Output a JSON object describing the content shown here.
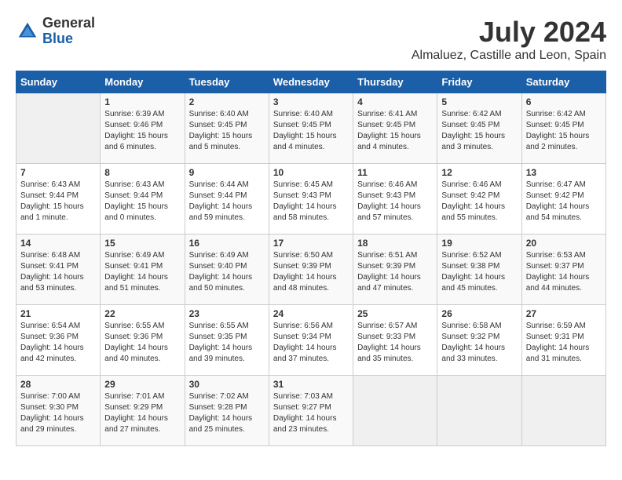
{
  "header": {
    "logo_general": "General",
    "logo_blue": "Blue",
    "month_year": "July 2024",
    "location": "Almaluez, Castille and Leon, Spain"
  },
  "days_of_week": [
    "Sunday",
    "Monday",
    "Tuesday",
    "Wednesday",
    "Thursday",
    "Friday",
    "Saturday"
  ],
  "weeks": [
    [
      {
        "day": "",
        "info": ""
      },
      {
        "day": "1",
        "info": "Sunrise: 6:39 AM\nSunset: 9:46 PM\nDaylight: 15 hours\nand 6 minutes."
      },
      {
        "day": "2",
        "info": "Sunrise: 6:40 AM\nSunset: 9:45 PM\nDaylight: 15 hours\nand 5 minutes."
      },
      {
        "day": "3",
        "info": "Sunrise: 6:40 AM\nSunset: 9:45 PM\nDaylight: 15 hours\nand 4 minutes."
      },
      {
        "day": "4",
        "info": "Sunrise: 6:41 AM\nSunset: 9:45 PM\nDaylight: 15 hours\nand 4 minutes."
      },
      {
        "day": "5",
        "info": "Sunrise: 6:42 AM\nSunset: 9:45 PM\nDaylight: 15 hours\nand 3 minutes."
      },
      {
        "day": "6",
        "info": "Sunrise: 6:42 AM\nSunset: 9:45 PM\nDaylight: 15 hours\nand 2 minutes."
      }
    ],
    [
      {
        "day": "7",
        "info": "Sunrise: 6:43 AM\nSunset: 9:44 PM\nDaylight: 15 hours\nand 1 minute."
      },
      {
        "day": "8",
        "info": "Sunrise: 6:43 AM\nSunset: 9:44 PM\nDaylight: 15 hours\nand 0 minutes."
      },
      {
        "day": "9",
        "info": "Sunrise: 6:44 AM\nSunset: 9:44 PM\nDaylight: 14 hours\nand 59 minutes."
      },
      {
        "day": "10",
        "info": "Sunrise: 6:45 AM\nSunset: 9:43 PM\nDaylight: 14 hours\nand 58 minutes."
      },
      {
        "day": "11",
        "info": "Sunrise: 6:46 AM\nSunset: 9:43 PM\nDaylight: 14 hours\nand 57 minutes."
      },
      {
        "day": "12",
        "info": "Sunrise: 6:46 AM\nSunset: 9:42 PM\nDaylight: 14 hours\nand 55 minutes."
      },
      {
        "day": "13",
        "info": "Sunrise: 6:47 AM\nSunset: 9:42 PM\nDaylight: 14 hours\nand 54 minutes."
      }
    ],
    [
      {
        "day": "14",
        "info": "Sunrise: 6:48 AM\nSunset: 9:41 PM\nDaylight: 14 hours\nand 53 minutes."
      },
      {
        "day": "15",
        "info": "Sunrise: 6:49 AM\nSunset: 9:41 PM\nDaylight: 14 hours\nand 51 minutes."
      },
      {
        "day": "16",
        "info": "Sunrise: 6:49 AM\nSunset: 9:40 PM\nDaylight: 14 hours\nand 50 minutes."
      },
      {
        "day": "17",
        "info": "Sunrise: 6:50 AM\nSunset: 9:39 PM\nDaylight: 14 hours\nand 48 minutes."
      },
      {
        "day": "18",
        "info": "Sunrise: 6:51 AM\nSunset: 9:39 PM\nDaylight: 14 hours\nand 47 minutes."
      },
      {
        "day": "19",
        "info": "Sunrise: 6:52 AM\nSunset: 9:38 PM\nDaylight: 14 hours\nand 45 minutes."
      },
      {
        "day": "20",
        "info": "Sunrise: 6:53 AM\nSunset: 9:37 PM\nDaylight: 14 hours\nand 44 minutes."
      }
    ],
    [
      {
        "day": "21",
        "info": "Sunrise: 6:54 AM\nSunset: 9:36 PM\nDaylight: 14 hours\nand 42 minutes."
      },
      {
        "day": "22",
        "info": "Sunrise: 6:55 AM\nSunset: 9:36 PM\nDaylight: 14 hours\nand 40 minutes."
      },
      {
        "day": "23",
        "info": "Sunrise: 6:55 AM\nSunset: 9:35 PM\nDaylight: 14 hours\nand 39 minutes."
      },
      {
        "day": "24",
        "info": "Sunrise: 6:56 AM\nSunset: 9:34 PM\nDaylight: 14 hours\nand 37 minutes."
      },
      {
        "day": "25",
        "info": "Sunrise: 6:57 AM\nSunset: 9:33 PM\nDaylight: 14 hours\nand 35 minutes."
      },
      {
        "day": "26",
        "info": "Sunrise: 6:58 AM\nSunset: 9:32 PM\nDaylight: 14 hours\nand 33 minutes."
      },
      {
        "day": "27",
        "info": "Sunrise: 6:59 AM\nSunset: 9:31 PM\nDaylight: 14 hours\nand 31 minutes."
      }
    ],
    [
      {
        "day": "28",
        "info": "Sunrise: 7:00 AM\nSunset: 9:30 PM\nDaylight: 14 hours\nand 29 minutes."
      },
      {
        "day": "29",
        "info": "Sunrise: 7:01 AM\nSunset: 9:29 PM\nDaylight: 14 hours\nand 27 minutes."
      },
      {
        "day": "30",
        "info": "Sunrise: 7:02 AM\nSunset: 9:28 PM\nDaylight: 14 hours\nand 25 minutes."
      },
      {
        "day": "31",
        "info": "Sunrise: 7:03 AM\nSunset: 9:27 PM\nDaylight: 14 hours\nand 23 minutes."
      },
      {
        "day": "",
        "info": ""
      },
      {
        "day": "",
        "info": ""
      },
      {
        "day": "",
        "info": ""
      }
    ]
  ]
}
